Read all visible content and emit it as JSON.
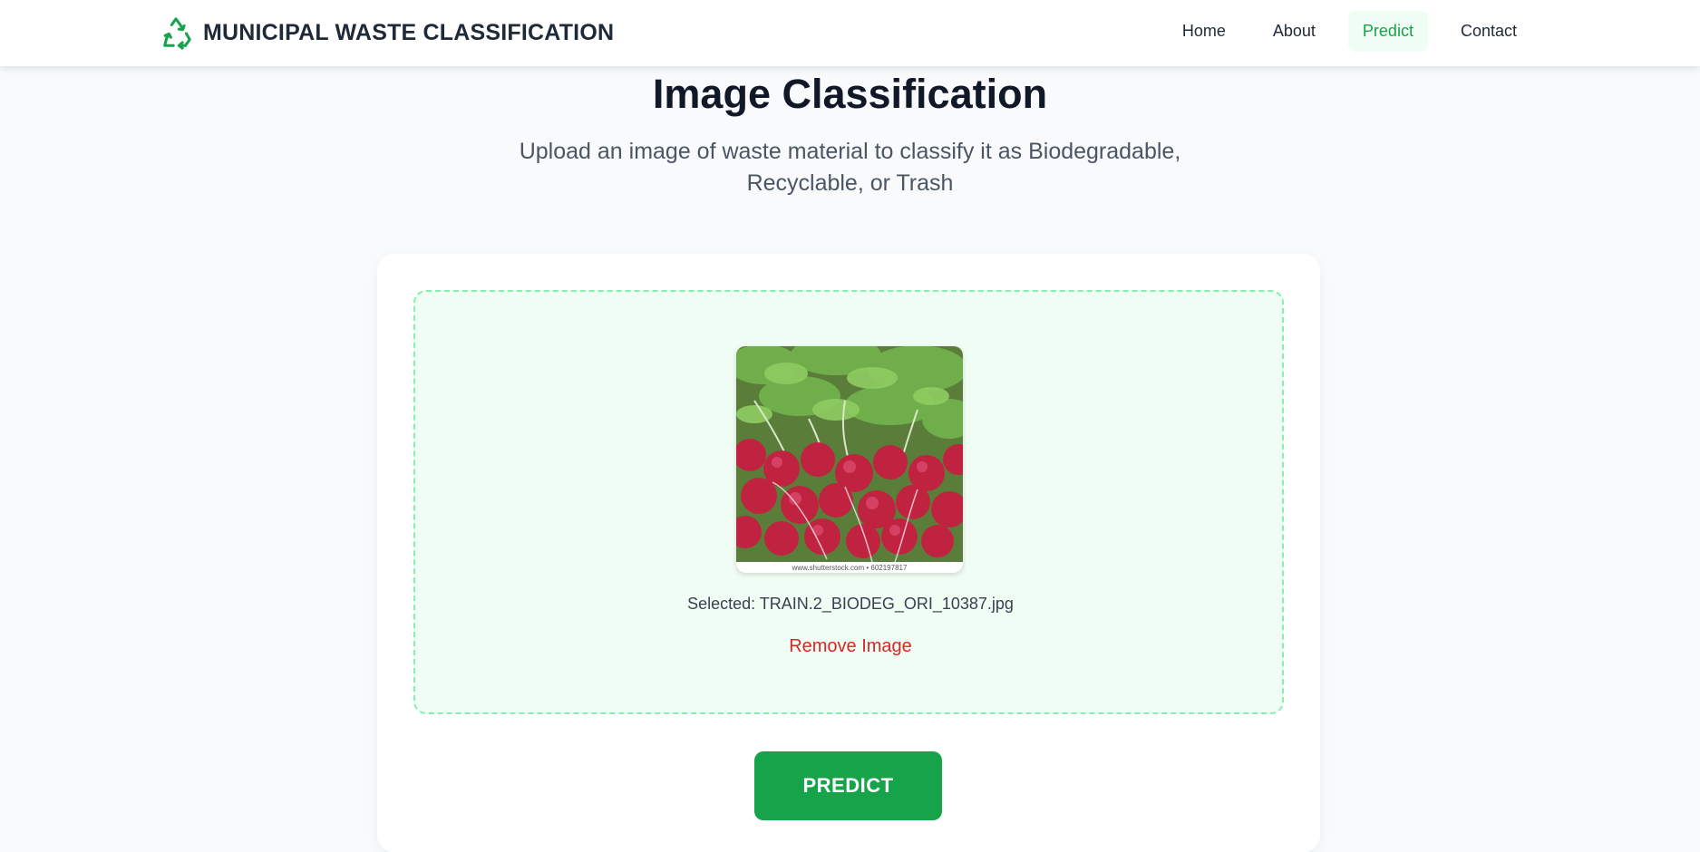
{
  "brand": {
    "title": "MUNICIPAL WASTE CLASSIFICATION",
    "icon": "recycle-icon",
    "icon_color": "#16a34a"
  },
  "nav": {
    "items": [
      {
        "label": "Home",
        "active": false
      },
      {
        "label": "About",
        "active": false
      },
      {
        "label": "Predict",
        "active": true
      },
      {
        "label": "Contact",
        "active": false
      }
    ]
  },
  "page": {
    "title": "Image Classification",
    "subtitle": "Upload an image of waste material to classify it as Biodegradable, Recyclable, or Trash"
  },
  "upload": {
    "preview_watermark": "www.shutterstock.com • 602197817",
    "selected_prefix": "Selected: ",
    "selected_filename": "TRAIN.2_BIODEG_ORI_10387.jpg",
    "remove_label": "Remove Image"
  },
  "actions": {
    "predict_label": "PREDICT"
  },
  "colors": {
    "accent": "#16a34a",
    "accent_light": "#f0fdf4",
    "dropzone_border": "#86efac",
    "danger": "#dc2626",
    "background": "#f8fafc"
  }
}
